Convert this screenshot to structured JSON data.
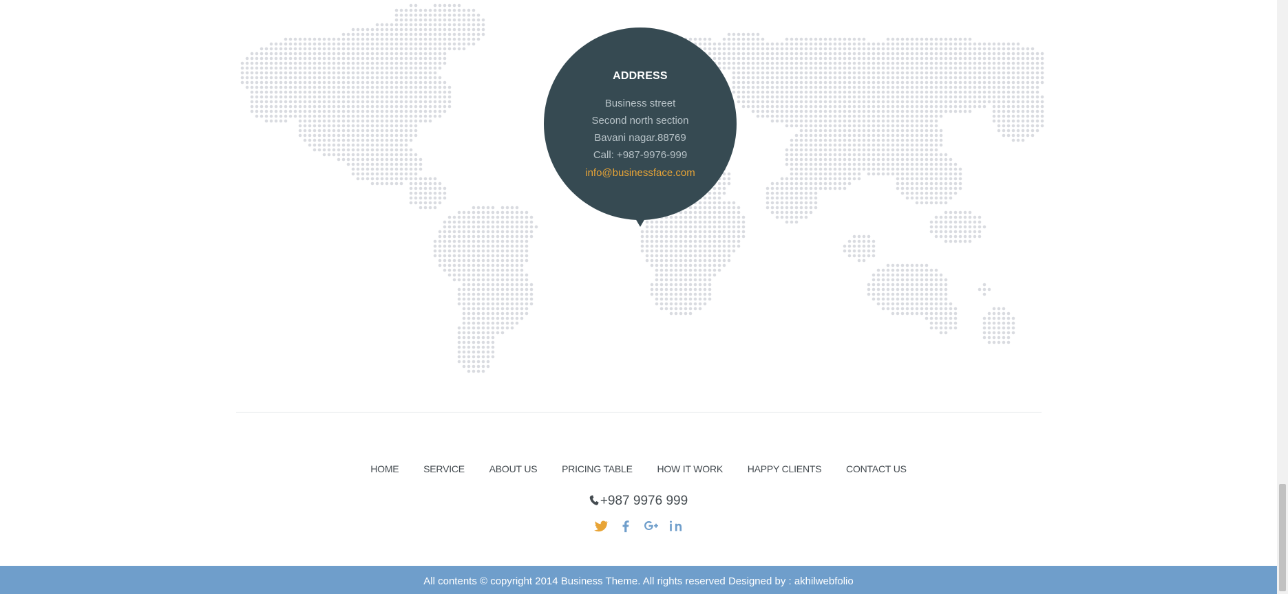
{
  "address": {
    "title": "ADDRESS",
    "lines": [
      "Business street",
      "Second north section",
      "Bavani nagar.88769",
      "Call: +987-9976-999"
    ],
    "email": "info@businessface.com"
  },
  "nav": {
    "items": [
      "HOME",
      "SERVICE",
      "ABOUT US",
      "PRICING TABLE",
      "HOW IT WORK",
      "HAPPY CLIENTS",
      "CONTACT US"
    ]
  },
  "contact": {
    "phone": "+987 9976 999"
  },
  "social": {
    "icons": [
      "twitter-icon",
      "facebook-icon",
      "google-plus-icon",
      "linkedin-icon"
    ]
  },
  "footer": {
    "copyright": "All contents © copyright 2014 Business Theme. All rights reserved Designed by : akhilwebfolio"
  },
  "colors": {
    "bubble": "#364a52",
    "email": "#e8a436",
    "footer_bar": "#6f9ecb",
    "map_dots": "#d9dbe0",
    "twitter": "#e8a436",
    "social": "#6f9ecb"
  }
}
